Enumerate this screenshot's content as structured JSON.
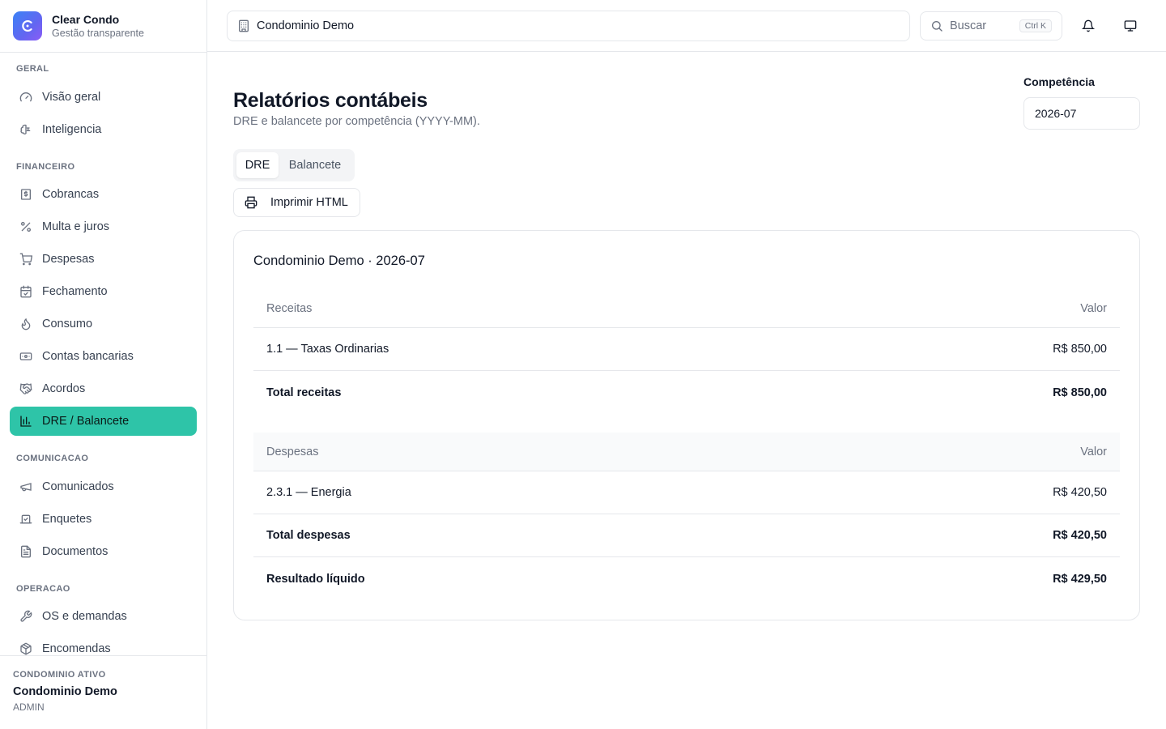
{
  "brand": {
    "name": "Clear Condo",
    "subtitle": "Gestão transparente"
  },
  "sidebar": {
    "sections": [
      {
        "label": "GERAL",
        "items": [
          {
            "label": "Visão geral",
            "icon": "gauge-icon"
          },
          {
            "label": "Inteligencia",
            "icon": "brain-icon"
          }
        ]
      },
      {
        "label": "FINANCEIRO",
        "items": [
          {
            "label": "Cobrancas",
            "icon": "receipt-icon"
          },
          {
            "label": "Multa e juros",
            "icon": "percent-icon"
          },
          {
            "label": "Despesas",
            "icon": "cart-icon"
          },
          {
            "label": "Fechamento",
            "icon": "calendar-check-icon"
          },
          {
            "label": "Consumo",
            "icon": "flame-icon"
          },
          {
            "label": "Contas bancarias",
            "icon": "banknote-icon"
          },
          {
            "label": "Acordos",
            "icon": "handshake-icon"
          },
          {
            "label": "DRE / Balancete",
            "icon": "bar-chart-icon",
            "active": true
          }
        ]
      },
      {
        "label": "COMUNICACAO",
        "items": [
          {
            "label": "Comunicados",
            "icon": "megaphone-icon"
          },
          {
            "label": "Enquetes",
            "icon": "vote-icon"
          },
          {
            "label": "Documentos",
            "icon": "file-text-icon"
          }
        ]
      },
      {
        "label": "OPERACAO",
        "items": [
          {
            "label": "OS e demandas",
            "icon": "wrench-icon"
          },
          {
            "label": "Encomendas",
            "icon": "package-icon"
          }
        ]
      }
    ],
    "footer": {
      "label": "CONDOMINIO ATIVO",
      "name": "Condominio Demo",
      "role": "ADMIN"
    }
  },
  "topbar": {
    "condo_selector": "Condominio Demo",
    "search_placeholder": "Buscar",
    "search_shortcut": "Ctrl K"
  },
  "page": {
    "title": "Relatórios contábeis",
    "subtitle": "DRE e balancete por competência (YYYY-MM).",
    "competencia_label": "Competência",
    "competencia_value": "2026-07",
    "tabs": [
      {
        "label": "DRE",
        "active": true
      },
      {
        "label": "Balancete",
        "active": false
      }
    ],
    "print_label": "Imprimir HTML"
  },
  "report": {
    "title": "Condominio Demo · 2026-07",
    "receitas": {
      "header": "Receitas",
      "value_header": "Valor",
      "rows": [
        {
          "label": "1.1 — Taxas Ordinarias",
          "value": "R$ 850,00"
        }
      ],
      "total": {
        "label": "Total receitas",
        "value": "R$ 850,00"
      }
    },
    "despesas": {
      "header": "Despesas",
      "value_header": "Valor",
      "rows": [
        {
          "label": "2.3.1 — Energia",
          "value": "R$ 420,50"
        }
      ],
      "total": {
        "label": "Total despesas",
        "value": "R$ 420,50"
      }
    },
    "resultado": {
      "label": "Resultado líquido",
      "value": "R$ 429,50"
    }
  },
  "colors": {
    "accent": "#2ec4a8",
    "border": "#e5e7eb",
    "muted": "#6b7280"
  }
}
